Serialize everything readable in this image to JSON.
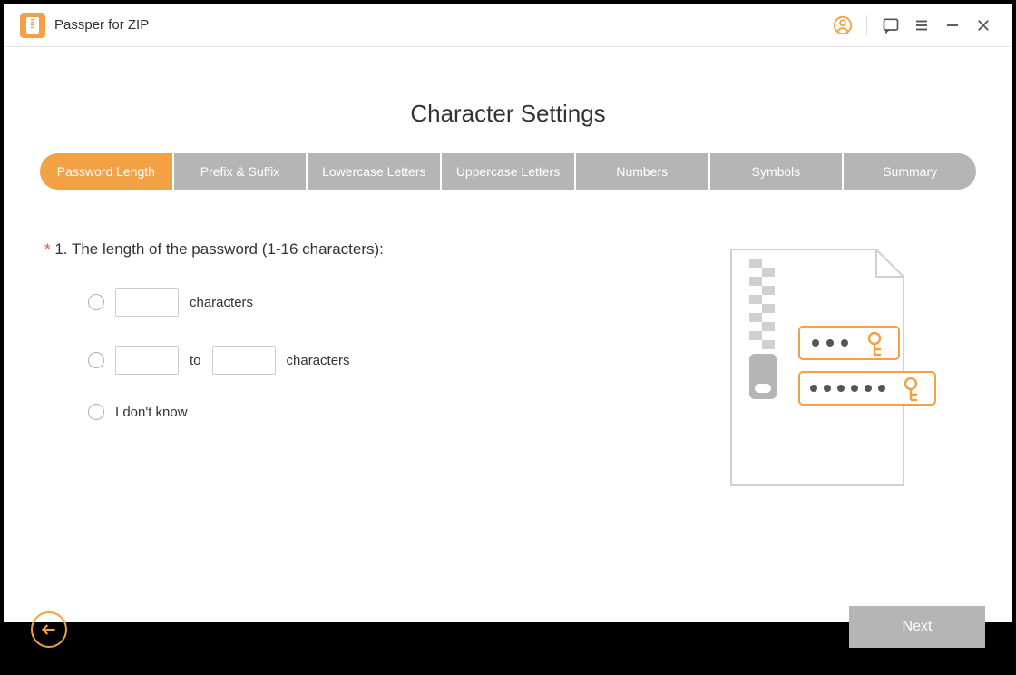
{
  "app": {
    "title": "Passper for ZIP"
  },
  "page": {
    "heading": "Character Settings"
  },
  "tabs": {
    "items": [
      {
        "label": "Password Length",
        "active": true
      },
      {
        "label": "Prefix & Suffix",
        "active": false
      },
      {
        "label": "Lowercase Letters",
        "active": false
      },
      {
        "label": "Uppercase Letters",
        "active": false
      },
      {
        "label": "Numbers",
        "active": false
      },
      {
        "label": "Symbols",
        "active": false
      },
      {
        "label": "Summary",
        "active": false
      }
    ]
  },
  "form": {
    "question_prefix": "*",
    "question": " 1. The length of the password (1-16 characters):",
    "option1_suffix": "characters",
    "option2_middle": "to",
    "option2_suffix": "characters",
    "option3_text": "I don't know",
    "exact_value": "",
    "range_from": "",
    "range_to": ""
  },
  "buttons": {
    "next": "Next"
  },
  "colors": {
    "accent": "#f2a144",
    "inactive_tab": "#b5b5b5"
  }
}
